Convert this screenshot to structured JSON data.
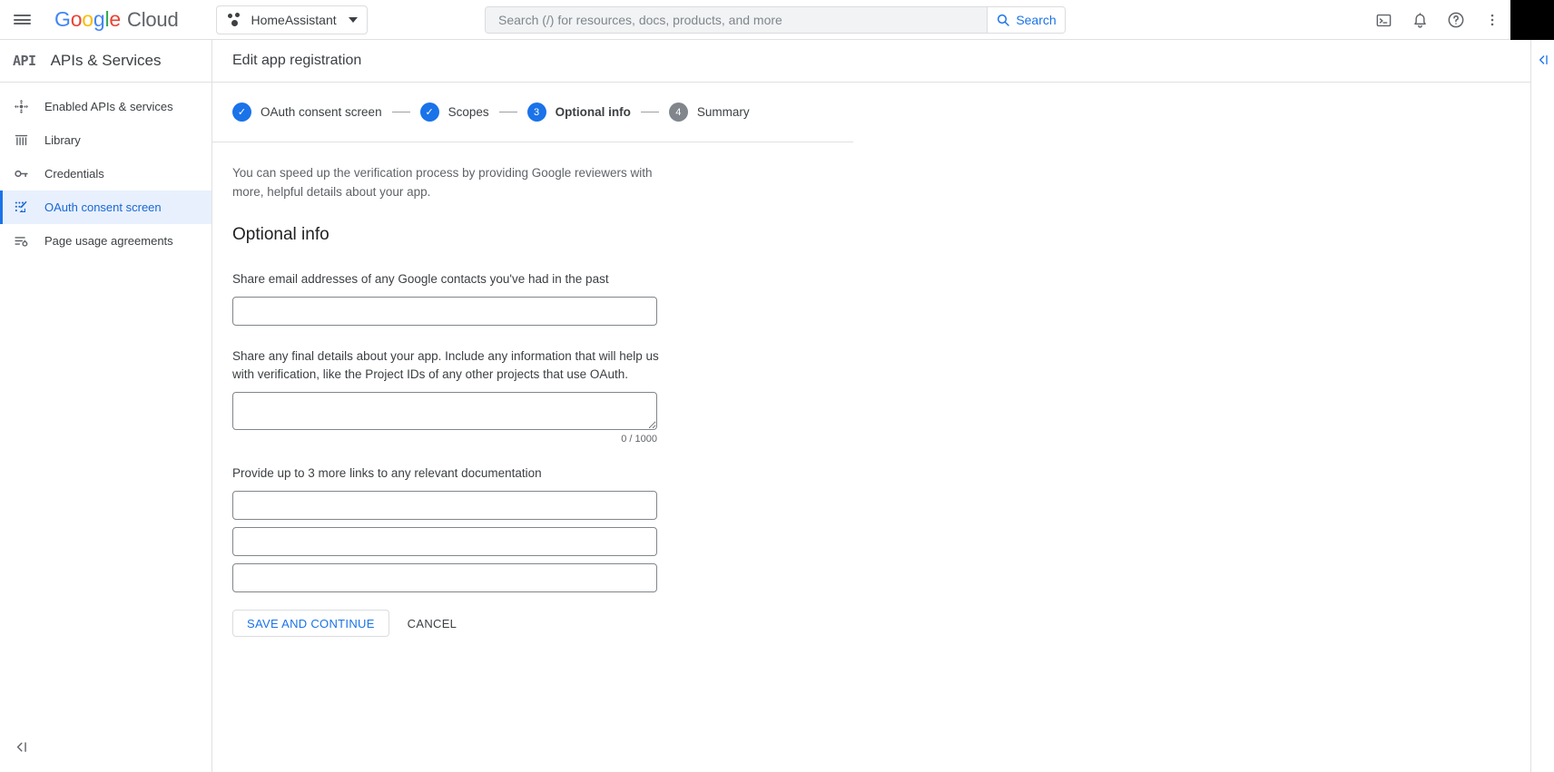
{
  "topbar": {
    "menu_icon": "hamburger-menu-icon",
    "brand": {
      "g": "G",
      "o1": "o",
      "o2": "o",
      "g2": "g",
      "l": "l",
      "e": "e",
      "cloud": "Cloud"
    },
    "project": {
      "name": "HomeAssistant",
      "icon": "project-dots-icon",
      "caret": "chevron-down-icon"
    },
    "search": {
      "placeholder": "Search (/) for resources, docs, products, and more",
      "value": "",
      "button_label": "Search",
      "icon": "search-icon"
    },
    "icons": [
      {
        "name": "cloud-shell-icon"
      },
      {
        "name": "notifications-bell-icon"
      },
      {
        "name": "help-question-icon"
      },
      {
        "name": "more-vert-icon"
      }
    ],
    "avatar": "user-avatar"
  },
  "sidebar": {
    "logo_text": "API",
    "title": "APIs & Services",
    "items": [
      {
        "label": "Enabled APIs & services",
        "icon": "enabled-apis-icon",
        "active": false
      },
      {
        "label": "Library",
        "icon": "library-icon",
        "active": false
      },
      {
        "label": "Credentials",
        "icon": "key-icon",
        "active": false
      },
      {
        "label": "OAuth consent screen",
        "icon": "oauth-consent-icon",
        "active": true
      },
      {
        "label": "Page usage agreements",
        "icon": "page-usage-icon",
        "active": false
      }
    ],
    "collapse_icon": "collapse-panel-icon"
  },
  "main": {
    "header_title": "Edit app registration",
    "stepper": [
      {
        "num": "1",
        "mark": "✓",
        "label": "OAuth consent screen",
        "state": "done"
      },
      {
        "num": "2",
        "mark": "✓",
        "label": "Scopes",
        "state": "done"
      },
      {
        "num": "3",
        "mark": "3",
        "label": "Optional info",
        "state": "current"
      },
      {
        "num": "4",
        "mark": "4",
        "label": "Summary",
        "state": "pending"
      }
    ],
    "intro": "You can speed up the verification process by providing Google reviewers with more, helpful details about your app.",
    "section_title": "Optional info",
    "fields": {
      "contacts_label": "Share email addresses of any Google contacts you've had in the past",
      "contacts_value": "",
      "details_label": "Share any final details about your app. Include any information that will help us with verification, like the Project IDs of any other projects that use OAuth.",
      "details_value": "",
      "details_counter": "0 / 1000",
      "links_label": "Provide up to 3 more links to any relevant documentation",
      "link1_value": "",
      "link2_value": "",
      "link3_value": ""
    },
    "actions": {
      "save_label": "SAVE AND CONTINUE",
      "cancel_label": "CANCEL"
    }
  },
  "right_rail": {
    "icon": "expand-side-panel-icon"
  },
  "colors": {
    "accent": "#1a73e8",
    "active_bg": "#e8f0fe",
    "text_primary": "#202124",
    "text_secondary": "#5f6368",
    "border": "#dadce0",
    "pending_step": "#80868b"
  }
}
